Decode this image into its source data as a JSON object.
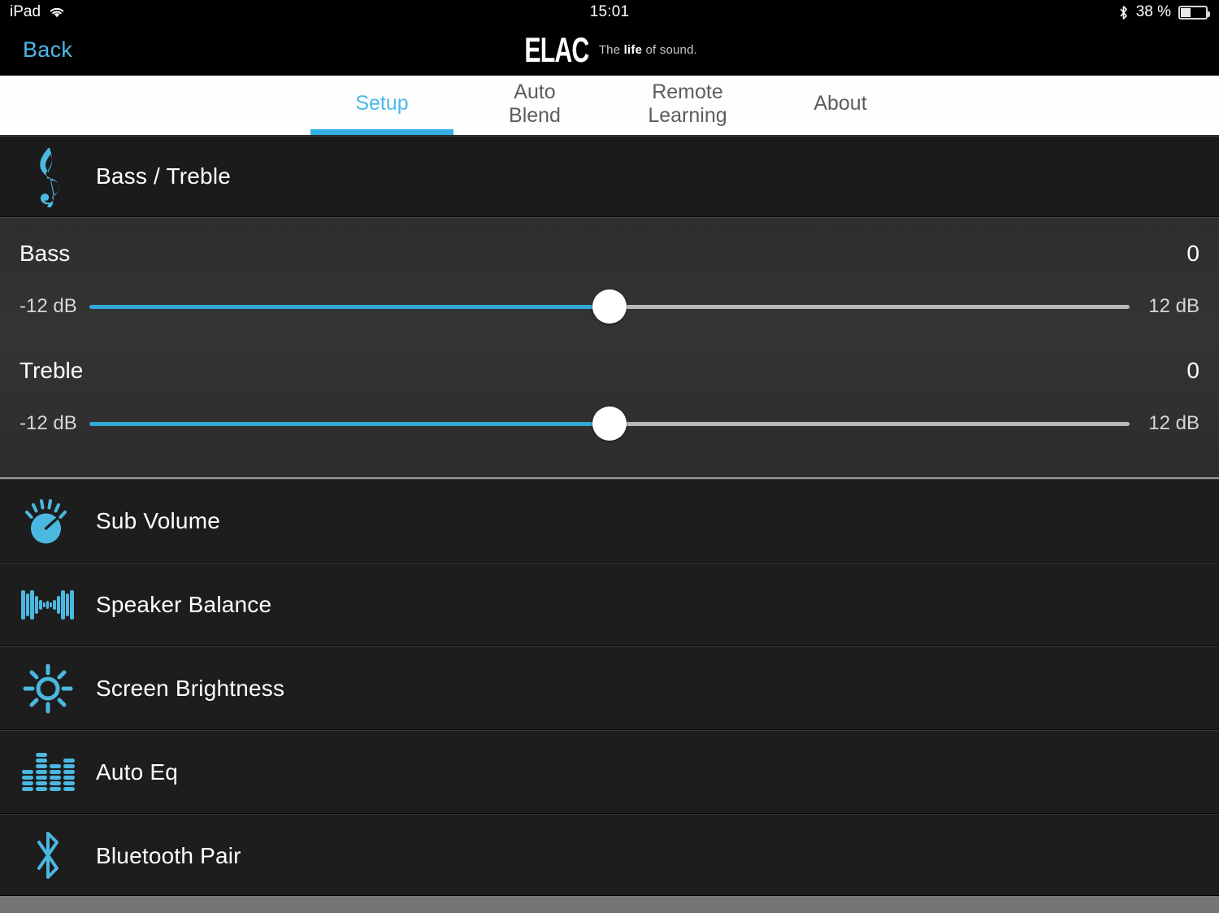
{
  "status_bar": {
    "device": "iPad",
    "wifi_icon": "wifi-icon",
    "time": "15:01",
    "bluetooth_icon": "bluetooth-icon",
    "battery_percent": "38 %",
    "battery_icon": "battery-icon"
  },
  "nav": {
    "back_label": "Back",
    "brand_name": "ELAC",
    "tagline_pre": "The ",
    "tagline_bold": "life",
    "tagline_post": " of sound."
  },
  "tabs": [
    {
      "label": "Setup",
      "active": true
    },
    {
      "label": "Auto\nBlend",
      "line1": "Auto",
      "line2": "Blend",
      "active": false
    },
    {
      "label": "Remote\nLearning",
      "line1": "Remote",
      "line2": "Learning",
      "active": false
    },
    {
      "label": "About",
      "line1": "About",
      "line2": "",
      "active": false
    }
  ],
  "section_header": {
    "icon": "treble-clef-icon",
    "title": "Bass / Treble"
  },
  "sliders": [
    {
      "name": "Bass",
      "value": "0",
      "min_label": "-12 dB",
      "max_label": "12 dB",
      "min": -12,
      "max": 12,
      "current": 0,
      "percent": 50
    },
    {
      "name": "Treble",
      "value": "0",
      "min_label": "-12 dB",
      "max_label": "12 dB",
      "min": -12,
      "max": 12,
      "current": 0,
      "percent": 50
    }
  ],
  "menu_items": [
    {
      "label": "Sub Volume",
      "icon": "volume-knob-icon"
    },
    {
      "label": "Speaker Balance",
      "icon": "speaker-balance-waveform-icon"
    },
    {
      "label": "Screen Brightness",
      "icon": "sun-brightness-icon"
    },
    {
      "label": "Auto Eq",
      "icon": "equalizer-bars-icon"
    },
    {
      "label": "Bluetooth Pair",
      "icon": "bluetooth-icon"
    }
  ],
  "colors": {
    "accent": "#33a8d8",
    "accent_light": "#4cb8e8",
    "icon_blue": "#4ab8e0",
    "row_background": "#1d1d1d",
    "panel_background": "#343434",
    "track_inactive": "#b9b9b9"
  }
}
